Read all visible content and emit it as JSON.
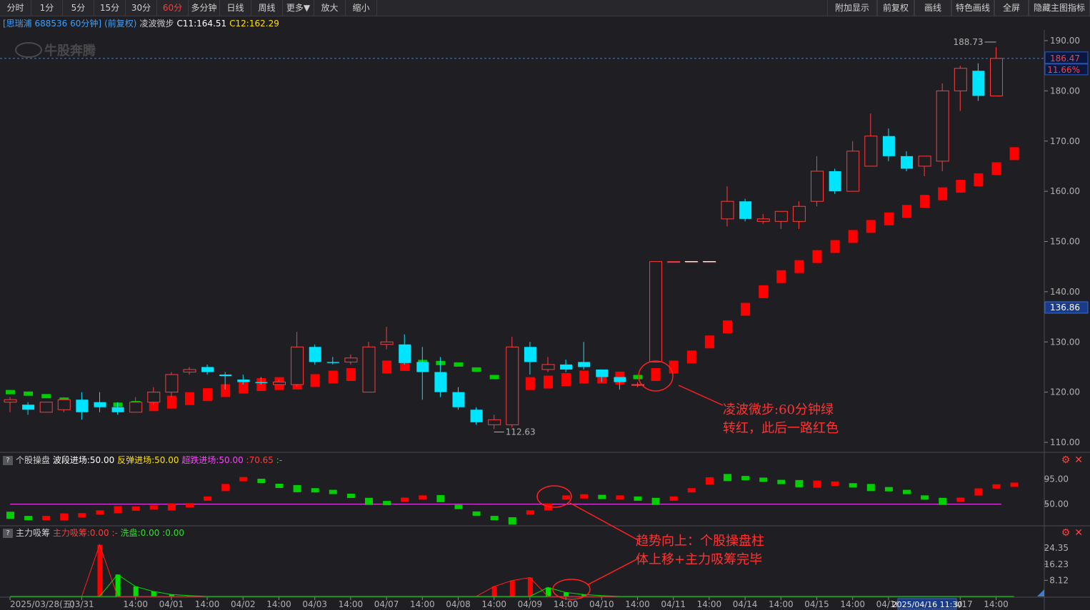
{
  "toolbar": {
    "left": [
      {
        "id": "fenshi",
        "label": "分时"
      },
      {
        "id": "1min",
        "label": "1分"
      },
      {
        "id": "5min",
        "label": "5分"
      },
      {
        "id": "15min",
        "label": "15分"
      },
      {
        "id": "30min",
        "label": "30分"
      },
      {
        "id": "60min",
        "label": "60分",
        "active": true
      },
      {
        "id": "multi",
        "label": "多分钟"
      },
      {
        "id": "day",
        "label": "日线"
      },
      {
        "id": "week",
        "label": "周线"
      },
      {
        "id": "more",
        "label": "更多▼"
      },
      {
        "id": "zoomin",
        "label": "放大"
      },
      {
        "id": "zoomout",
        "label": "缩小"
      }
    ],
    "right": [
      {
        "id": "extra",
        "label": "附加显示"
      },
      {
        "id": "fq",
        "label": "前复权"
      },
      {
        "id": "draw",
        "label": "画线"
      },
      {
        "id": "special",
        "label": "特色画线"
      },
      {
        "id": "full",
        "label": "全屏"
      },
      {
        "id": "hide",
        "label": "隐藏主图指标"
      }
    ]
  },
  "info": {
    "stock": "[思瑞浦 688536 60分钟]",
    "adj": "(前复权)",
    "indicator": "凌波微步",
    "c11": "C11:164.51",
    "c12": "C12:162.29"
  },
  "watermark": "牛股奔腾",
  "colors": {
    "up": "#ff3b3b",
    "down": "#00e5ff",
    "dot_up": "#ff0000",
    "dot_down": "#00cc00",
    "bg": "#1f1f23",
    "accent": "#ff3b3b",
    "cursor": "#5aa0ff"
  },
  "chart_data": {
    "type": "candlestick",
    "interval": "60分钟",
    "ylim": [
      108,
      192
    ],
    "y_ticks": [
      110,
      120,
      130,
      140,
      150,
      160,
      170,
      180,
      190
    ],
    "current": {
      "price": "186.47",
      "pct": "11.66%"
    },
    "cursor_value": "136.86",
    "high_label": "188.73",
    "low_label": "112.63",
    "candles": [
      [
        118,
        118.5,
        116,
        119
      ],
      [
        117.5,
        116.5,
        115.5,
        118
      ],
      [
        116,
        118,
        116,
        118
      ],
      [
        116.5,
        118.5,
        116,
        119
      ],
      [
        118.5,
        116,
        114.5,
        120
      ],
      [
        118,
        117,
        116,
        120
      ],
      [
        117,
        116,
        115.5,
        118
      ],
      [
        116,
        118,
        116,
        119
      ],
      [
        118,
        120,
        117.5,
        121
      ],
      [
        120,
        123.5,
        119,
        124
      ],
      [
        124,
        124.5,
        123.5,
        125
      ],
      [
        125,
        124,
        123.5,
        125.5
      ],
      [
        123.5,
        123.2,
        120.5,
        124
      ],
      [
        122.5,
        122,
        121.5,
        123.5
      ],
      [
        122,
        121.8,
        121.5,
        123
      ],
      [
        121.5,
        122,
        121.5,
        122.5
      ],
      [
        121.5,
        129,
        121,
        132
      ],
      [
        129,
        126,
        125.5,
        129.5
      ],
      [
        126,
        125.8,
        125.5,
        127
      ],
      [
        126,
        126.8,
        125.5,
        127.5
      ],
      [
        120,
        129,
        120,
        130
      ],
      [
        129.5,
        130,
        128.5,
        133
      ],
      [
        129.5,
        125.8,
        125.5,
        131.5
      ],
      [
        126,
        124,
        118.5,
        129
      ],
      [
        124,
        120,
        119,
        127
      ],
      [
        120,
        117,
        116.5,
        121
      ],
      [
        116.5,
        114,
        113.5,
        117
      ],
      [
        113.5,
        114.5,
        112.63,
        115.5
      ],
      [
        113.5,
        129,
        113,
        131
      ],
      [
        129,
        126,
        123.5,
        130
      ],
      [
        124.5,
        125.5,
        124,
        127
      ],
      [
        125.5,
        124.5,
        124,
        126.5
      ],
      [
        126,
        125,
        124.5,
        130
      ],
      [
        124.5,
        123,
        122,
        124.5
      ],
      [
        123,
        122,
        120.5,
        123
      ],
      [
        121.5,
        121.5,
        121,
        122
      ],
      [
        126,
        146,
        126,
        146
      ],
      [
        146,
        146,
        146,
        146
      ],
      [
        146,
        146,
        146,
        146
      ],
      [
        146,
        146,
        146,
        146
      ],
      [
        154.5,
        158,
        153,
        161
      ],
      [
        158,
        154.5,
        154,
        158.5
      ],
      [
        154,
        154.5,
        153.5,
        155.5
      ],
      [
        154,
        156,
        152.5,
        156
      ],
      [
        154,
        157,
        152.5,
        158
      ],
      [
        158,
        164,
        157,
        167
      ],
      [
        164,
        160,
        159.5,
        164.5
      ],
      [
        160,
        168,
        160,
        170
      ],
      [
        165,
        171,
        165,
        175.5
      ],
      [
        171,
        167,
        166,
        172.5
      ],
      [
        167,
        164.5,
        164,
        168
      ],
      [
        165,
        167,
        163,
        167
      ],
      [
        166,
        180,
        164,
        181.5
      ],
      [
        180,
        184.5,
        176,
        185
      ],
      [
        184,
        179,
        178,
        185.5
      ],
      [
        179,
        186.47,
        179,
        188.73
      ]
    ],
    "guide_dots": [
      [
        120,
        "g"
      ],
      [
        119.7,
        "g"
      ],
      [
        119.2,
        "g"
      ],
      [
        118.5,
        "g"
      ],
      [
        118,
        "g"
      ],
      [
        117.5,
        "g"
      ],
      [
        117.5,
        "g"
      ],
      [
        117.8,
        "g"
      ],
      [
        117.5,
        "r"
      ],
      [
        118,
        "r"
      ],
      [
        118.7,
        "r"
      ],
      [
        119.5,
        "r"
      ],
      [
        120.3,
        "r"
      ],
      [
        121,
        "r"
      ],
      [
        121.5,
        "r"
      ],
      [
        121.7,
        "r"
      ],
      [
        121.8,
        "r"
      ],
      [
        122.3,
        "r"
      ],
      [
        123,
        "r"
      ],
      [
        123.5,
        "r"
      ],
      [
        124.5,
        "r"
      ],
      [
        125,
        "r"
      ],
      [
        125.5,
        "r"
      ],
      [
        126,
        "g"
      ],
      [
        125.8,
        "g"
      ],
      [
        125.5,
        "g"
      ],
      [
        124.5,
        "g"
      ],
      [
        123,
        "g"
      ],
      [
        121.5,
        "g"
      ],
      [
        121.7,
        "r"
      ],
      [
        122,
        "r"
      ],
      [
        122.5,
        "r"
      ],
      [
        123,
        "r"
      ],
      [
        123,
        "r"
      ],
      [
        122.8,
        "r"
      ],
      [
        123,
        "g"
      ],
      [
        123.5,
        "r"
      ],
      [
        125,
        "r"
      ],
      [
        127,
        "r"
      ],
      [
        130,
        "r"
      ],
      [
        133,
        "r"
      ],
      [
        136.5,
        "r"
      ],
      [
        140,
        "r"
      ],
      [
        143,
        "r"
      ],
      [
        145,
        "r"
      ],
      [
        147,
        "r"
      ],
      [
        149,
        "r"
      ],
      [
        151,
        "r"
      ],
      [
        153,
        "r"
      ],
      [
        154.5,
        "r"
      ],
      [
        156,
        "r"
      ],
      [
        158,
        "r"
      ],
      [
        159.5,
        "r"
      ],
      [
        161,
        "r"
      ],
      [
        162.3,
        "r"
      ],
      [
        164.5,
        "r"
      ],
      [
        167.5,
        "r"
      ]
    ],
    "x_labels": [
      {
        "i": 0,
        "t": "2025/03/28(五)"
      },
      {
        "i": 4,
        "t": "03/31"
      },
      {
        "i": 7,
        "t": "14:00"
      },
      {
        "i": 9,
        "t": "04/01"
      },
      {
        "i": 11,
        "t": "14:00"
      },
      {
        "i": 13,
        "t": "04/02"
      },
      {
        "i": 15,
        "t": "14:00"
      },
      {
        "i": 17,
        "t": "04/03"
      },
      {
        "i": 19,
        "t": "14:00"
      },
      {
        "i": 21,
        "t": "04/07"
      },
      {
        "i": 23,
        "t": "14:00"
      },
      {
        "i": 25,
        "t": "04/08"
      },
      {
        "i": 27,
        "t": "14:00"
      },
      {
        "i": 29,
        "t": "04/09"
      },
      {
        "i": 31,
        "t": "14:00"
      },
      {
        "i": 33,
        "t": "04/10"
      },
      {
        "i": 35,
        "t": "14:00"
      },
      {
        "i": 37,
        "t": "04/11"
      },
      {
        "i": 39,
        "t": "14:00"
      },
      {
        "i": 41,
        "t": "04/14"
      },
      {
        "i": 43,
        "t": "14:00"
      },
      {
        "i": 45,
        "t": "04/15"
      },
      {
        "i": 47,
        "t": "14:00"
      },
      {
        "i": 49,
        "t": "04/16"
      },
      {
        "i": 53,
        "t": "04/17"
      },
      {
        "i": 55,
        "t": "14:00"
      }
    ],
    "cursor_time": "2025/04/16 11:30",
    "sub1": {
      "title": "个股操盘",
      "l1": "波段进场:50.00",
      "l2": "反弹进场:50.00",
      "l3": "超跌进场:50.00",
      "l4": ":70.65",
      "l5": ":-",
      "ylim": [
        20,
        110
      ],
      "y_ticks": [
        50,
        95
      ],
      "y_tick_labels": [
        "50.00",
        "95.00"
      ],
      "line": 50,
      "values": [
        [
          30,
          "g"
        ],
        [
          25,
          "g"
        ],
        [
          25,
          "r"
        ],
        [
          27,
          "r"
        ],
        [
          30,
          "r"
        ],
        [
          35,
          "r"
        ],
        [
          40,
          "r"
        ],
        [
          42,
          "r"
        ],
        [
          44,
          "r"
        ],
        [
          45,
          "r"
        ],
        [
          48,
          "r"
        ],
        [
          60,
          "r"
        ],
        [
          80,
          "r"
        ],
        [
          95,
          "r"
        ],
        [
          92,
          "g"
        ],
        [
          83,
          "g"
        ],
        [
          78,
          "g"
        ],
        [
          75,
          "g"
        ],
        [
          72,
          "g"
        ],
        [
          65,
          "g"
        ],
        [
          55,
          "g"
        ],
        [
          52,
          "g"
        ],
        [
          58,
          "r"
        ],
        [
          62,
          "r"
        ],
        [
          60,
          "g"
        ],
        [
          45,
          "g"
        ],
        [
          33,
          "g"
        ],
        [
          25,
          "g"
        ],
        [
          20,
          "g"
        ],
        [
          35,
          "r"
        ],
        [
          45,
          "r"
        ],
        [
          62,
          "r"
        ],
        [
          64,
          "r"
        ],
        [
          63,
          "g"
        ],
        [
          62,
          "r"
        ],
        [
          60,
          "g"
        ],
        [
          55,
          "g"
        ],
        [
          60,
          "r"
        ],
        [
          75,
          "r"
        ],
        [
          92,
          "r"
        ],
        [
          98,
          "g"
        ],
        [
          97,
          "g"
        ],
        [
          94,
          "g"
        ],
        [
          90,
          "g"
        ],
        [
          87,
          "g"
        ],
        [
          86,
          "r"
        ],
        [
          87,
          "r"
        ],
        [
          84,
          "g"
        ],
        [
          80,
          "g"
        ],
        [
          77,
          "g"
        ],
        [
          72,
          "g"
        ],
        [
          62,
          "g"
        ],
        [
          55,
          "g"
        ],
        [
          58,
          "r"
        ],
        [
          72,
          "r"
        ],
        [
          82,
          "r"
        ],
        [
          85,
          "r"
        ]
      ]
    },
    "sub2": {
      "title": "主力吸筹",
      "l1": "主力吸筹:0.00",
      "l2": ":-",
      "l3": "洗盘:0.00",
      "l4": ":0.00",
      "ylim": [
        0,
        28
      ],
      "y_ticks": [
        24.35,
        16.23,
        8.12
      ],
      "y_tick_labels": [
        "24.35",
        "16.23",
        "8.12"
      ],
      "red": [
        0,
        0,
        0,
        0,
        0,
        26,
        0,
        0,
        0,
        0,
        0,
        0,
        0,
        0,
        0,
        0,
        0,
        0,
        0,
        0,
        0,
        0,
        0,
        0,
        0,
        0,
        0,
        5,
        8,
        9.5,
        0,
        0,
        0,
        0,
        0,
        0,
        0,
        0,
        0,
        0,
        0,
        0,
        0,
        0,
        0,
        0,
        0,
        0,
        0,
        0,
        0,
        0,
        0,
        0,
        0,
        0,
        0
      ],
      "green": [
        0,
        0,
        0,
        0,
        0,
        0,
        11,
        5,
        2.5,
        1,
        0.4,
        0,
        0,
        0,
        0,
        0,
        0,
        0,
        0,
        0,
        0,
        0,
        0,
        0,
        0,
        0,
        0,
        0,
        0,
        0,
        4.5,
        2,
        1,
        0.4,
        0,
        0,
        0,
        0,
        0,
        0,
        0,
        0,
        0,
        0,
        0,
        0,
        0,
        0,
        0,
        0,
        0,
        0,
        0,
        0,
        0,
        0,
        0
      ]
    }
  },
  "annotations": {
    "a1_l1": "凌波微步:60分钟绿",
    "a1_l2": "转红，此后一路红色",
    "a2_l1": "趋势向上：个股操盘柱",
    "a2_l2": "体上移+主力吸筹完毕"
  },
  "icons": {
    "settings": "gear-icon",
    "close": "close-icon"
  },
  "glyphs": {
    "question": "?",
    "gear": "⚙",
    "close": "✕"
  }
}
